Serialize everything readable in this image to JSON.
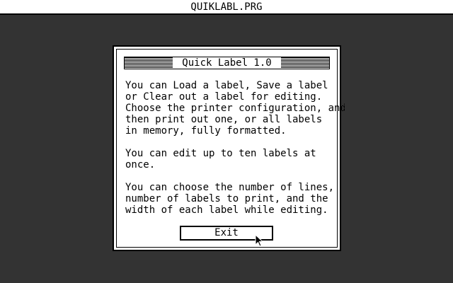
{
  "menubar": {
    "title": "QUIKLABL.PRG"
  },
  "dialog": {
    "title": "Quick Label 1.0",
    "paragraphs": [
      "You can Load a label, Save a label\nor Clear out a label for editing.\nChoose the printer configuration, and\nthen print out one, or all labels\nin memory, fully formatted.",
      "You can edit up to ten labels at\nonce.",
      "You can choose the number of lines,\nnumber of labels to print, and the\nwidth of each label while editing."
    ],
    "exit_label": "Exit"
  },
  "cursor": {
    "icon": "arrow-pointer-icon"
  },
  "colors": {
    "foreground": "#000000",
    "background": "#ffffff"
  }
}
